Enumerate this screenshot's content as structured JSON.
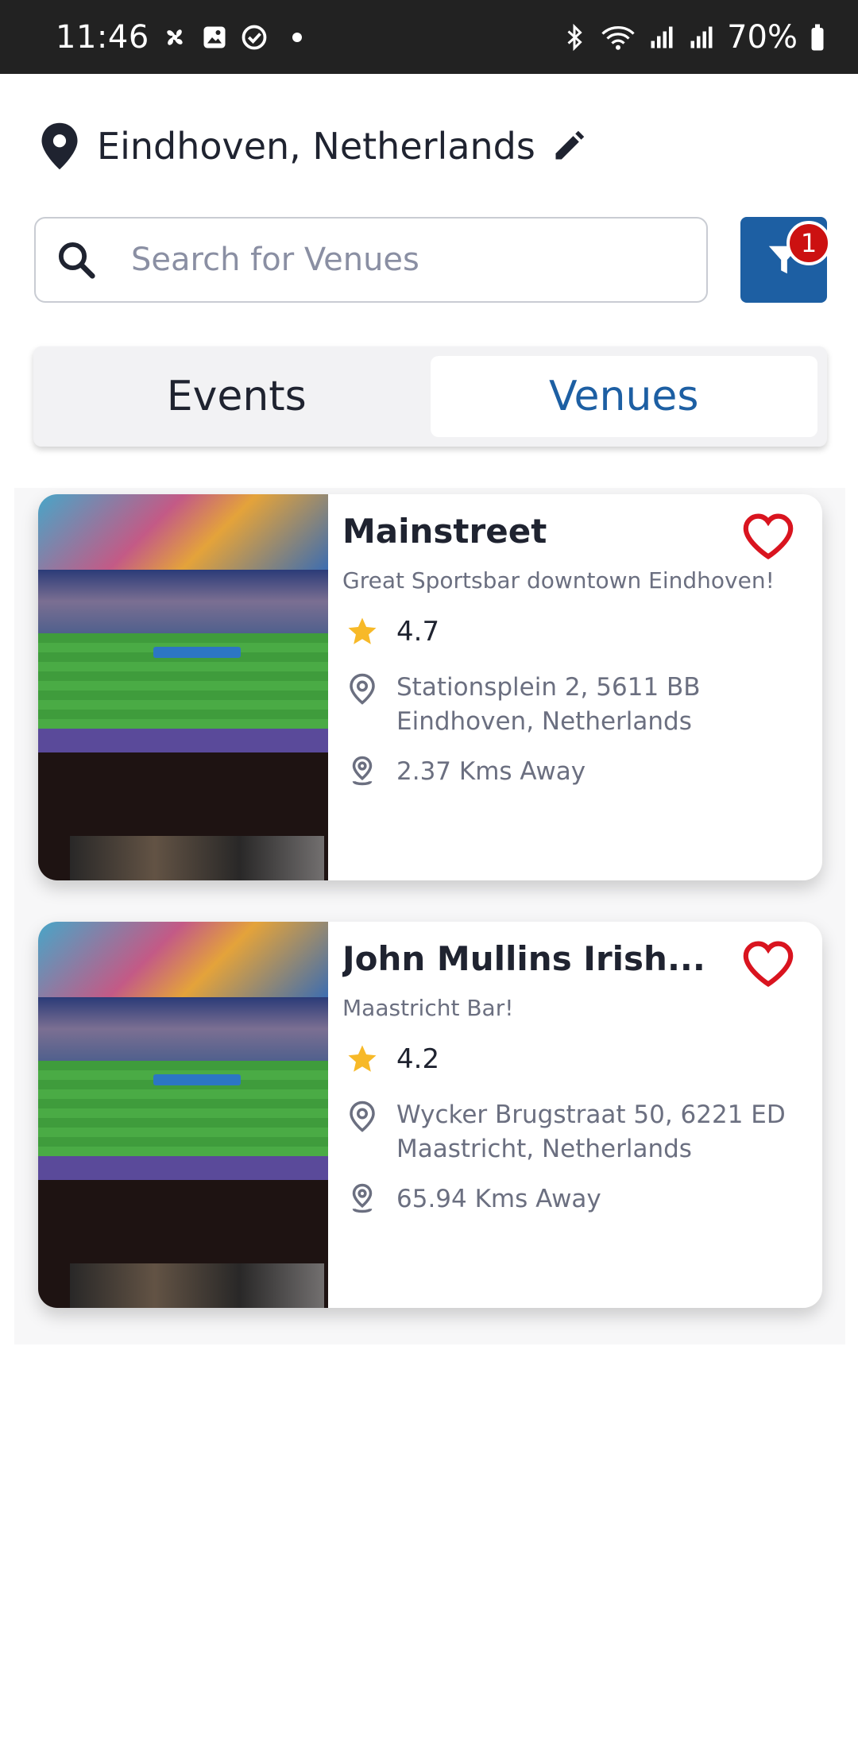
{
  "status_bar": {
    "time": "11:46",
    "battery": "70%",
    "icons": [
      "fan-icon",
      "gallery-icon",
      "check-circle-icon",
      "bluetooth-icon",
      "wifi-icon",
      "signal-icon",
      "battery-icon"
    ]
  },
  "location": {
    "text": "Eindhoven, Netherlands",
    "icon": "map-pin-icon",
    "edit_icon": "pencil-icon"
  },
  "search": {
    "placeholder": "Search for Venues",
    "value": ""
  },
  "filter": {
    "badge_count": "1",
    "color": "#1d5fa3",
    "badge_color": "#cc1111"
  },
  "tabs": {
    "events_label": "Events",
    "venues_label": "Venues",
    "active": "Venues"
  },
  "venues": [
    {
      "name": "Mainstreet",
      "description": "Great Sportsbar downtown Eindhoven!",
      "rating": "4.7",
      "address": "Stationsplein 2, 5611 BB Eindhoven, Netherlands",
      "distance": "2.37 Kms Away",
      "favorite": false
    },
    {
      "name": "John Mullins Irish...",
      "description": "Maastricht Bar!",
      "rating": "4.2",
      "address": "Wycker Brugstraat 50, 6221 ED Maastricht, Netherlands",
      "distance": "65.94 Kms Away",
      "favorite": false
    }
  ],
  "colors": {
    "accent": "#1d5fa3",
    "heart": "#d9141f",
    "star": "#f7b928"
  }
}
